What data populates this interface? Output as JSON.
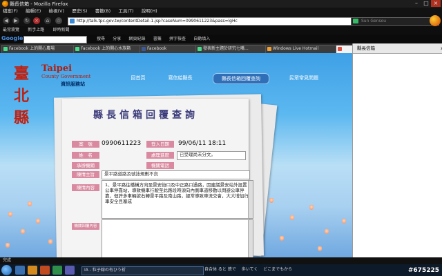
{
  "window": {
    "title": "縣長信箱 - Mozilla Firefox"
  },
  "menu": [
    "檔案(F)",
    "編輯(E)",
    "檢視(V)",
    "歷史(S)",
    "書籤(B)",
    "工具(T)",
    "說明(H)"
  ],
  "nav": {
    "url": "http://talk.tpc.gov.tw/contentDetail-1.jsp?caseNum=0990611223&pass=lgHc",
    "search_placeholder": "Sun Gensou"
  },
  "bookmarks": [
    "最常瀏覽",
    "新手上路",
    "即時新聞"
  ],
  "google": {
    "logo": "Google",
    "items": [
      "搜尋",
      "分享",
      "網頁紀錄",
      "書籤",
      "拼字檢查",
      "自動填入"
    ]
  },
  "tabs": [
    "Facebook 上的開心農場",
    "Facebook 上的開心水族箱",
    "Facebook",
    "發表新主題於研究七嘴...",
    "Windows Live Hotmail",
    ""
  ],
  "sidebar": {
    "title": "縣長信箱",
    "close": "x"
  },
  "site": {
    "logo_cn": "臺北縣",
    "logo_en": "Taipei",
    "logo_en2": "County Government",
    "logo_service": "資訊服務站",
    "nav": [
      "回首頁",
      "寫信給縣長",
      "縣長信箱回覆查詢",
      "民眾常見問題"
    ]
  },
  "form": {
    "heading": "縣長信箱回覆查詢",
    "labels": {
      "case": "案　號",
      "date": "登入日期",
      "name": "姓　名",
      "status": "處理進度",
      "agency": "承辦機關",
      "phone": "機關電話",
      "subject": "陳情主旨",
      "content": "陳情內容",
      "reply": "機關回覆內容"
    },
    "case_number": "0990611223",
    "date": "99/06/11 18:11",
    "status": "已受理尚未分文。",
    "subject": "景平路道路及號誌規劃不良",
    "content": "1、景平路往橋橫方向至景安街口及中正路口過路，因建議景安站外設置公車停靠站，導致機車行駛至此路段時須向內側車道移動以閃避公車停靠，但許多車輛欲右轉景平路及南山路，經常導致車流交會，大大增加行車安全且塞成"
  },
  "status_bar": "完成",
  "taskbar": {
    "media": "IA - 粒子線の有ひう祈",
    "lyrics": "自合体 ると 鉄で　 歩いてく　 どこまでもから",
    "watermark": "#675225"
  }
}
